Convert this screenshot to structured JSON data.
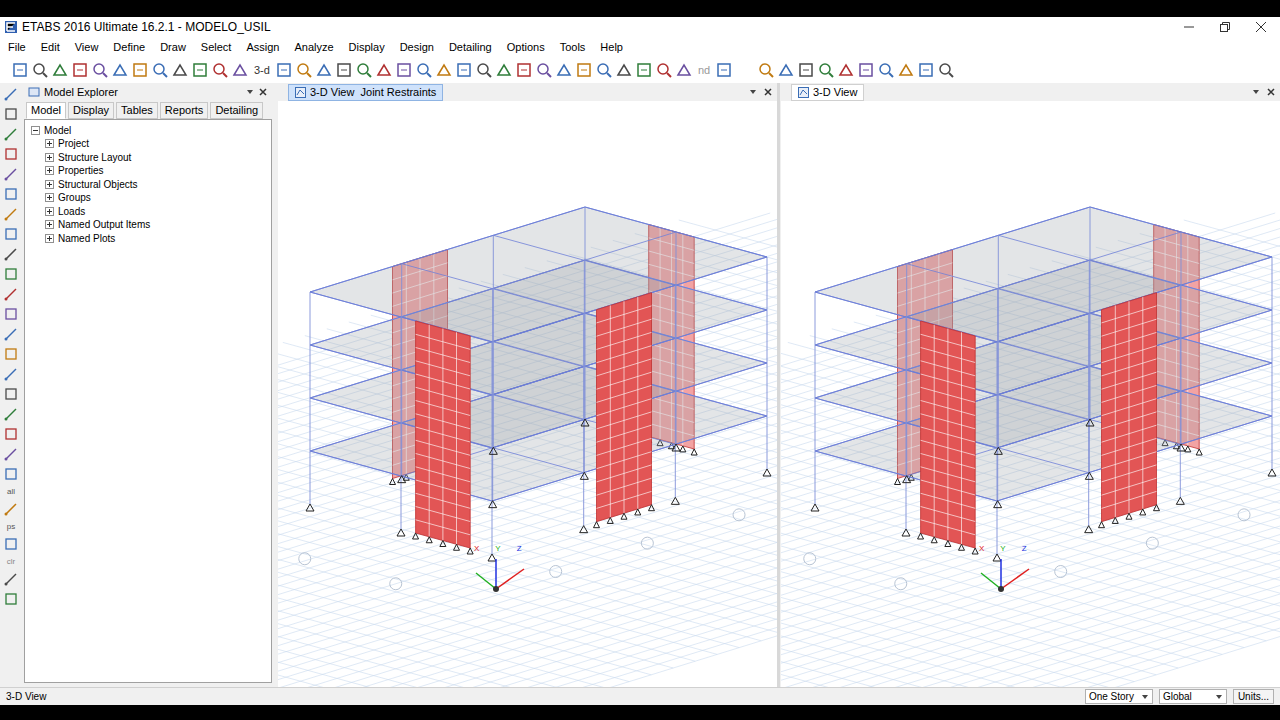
{
  "window": {
    "title": "ETABS 2016 Ultimate 16.2.1 - MODELO_USIL"
  },
  "menu": [
    "File",
    "Edit",
    "View",
    "Define",
    "Draw",
    "Select",
    "Assign",
    "Analyze",
    "Display",
    "Design",
    "Detailing",
    "Options",
    "Tools",
    "Help"
  ],
  "toolbar": {
    "texts": [
      "3-d",
      "nd"
    ]
  },
  "left_toolbar": {
    "texts": [
      "all",
      "ps",
      "clr"
    ]
  },
  "explorer": {
    "title": "Model Explorer",
    "tabs": [
      {
        "label": "Model",
        "selected": true
      },
      {
        "label": "Display",
        "selected": false
      },
      {
        "label": "Tables",
        "selected": false
      },
      {
        "label": "Reports",
        "selected": false
      },
      {
        "label": "Detailing",
        "selected": false
      }
    ],
    "tree": {
      "label": "Model",
      "expanded": true,
      "children": [
        {
          "label": "Project",
          "expanded": false
        },
        {
          "label": "Structure Layout",
          "expanded": false
        },
        {
          "label": "Properties",
          "expanded": false
        },
        {
          "label": "Structural Objects",
          "expanded": false
        },
        {
          "label": "Groups",
          "expanded": false
        },
        {
          "label": "Loads",
          "expanded": false
        },
        {
          "label": "Named Output Items",
          "expanded": false
        },
        {
          "label": "Named Plots",
          "expanded": false
        }
      ]
    }
  },
  "views": [
    {
      "title": "3-D View  Joint Restraints",
      "selected": true
    },
    {
      "title": "3-D View",
      "selected": false
    }
  ],
  "axes": [
    "X",
    "Y",
    "Z"
  ],
  "status_bar": {
    "left": "3-D View",
    "dropdowns": [
      "One Story",
      "Global"
    ],
    "units": "Units..."
  }
}
